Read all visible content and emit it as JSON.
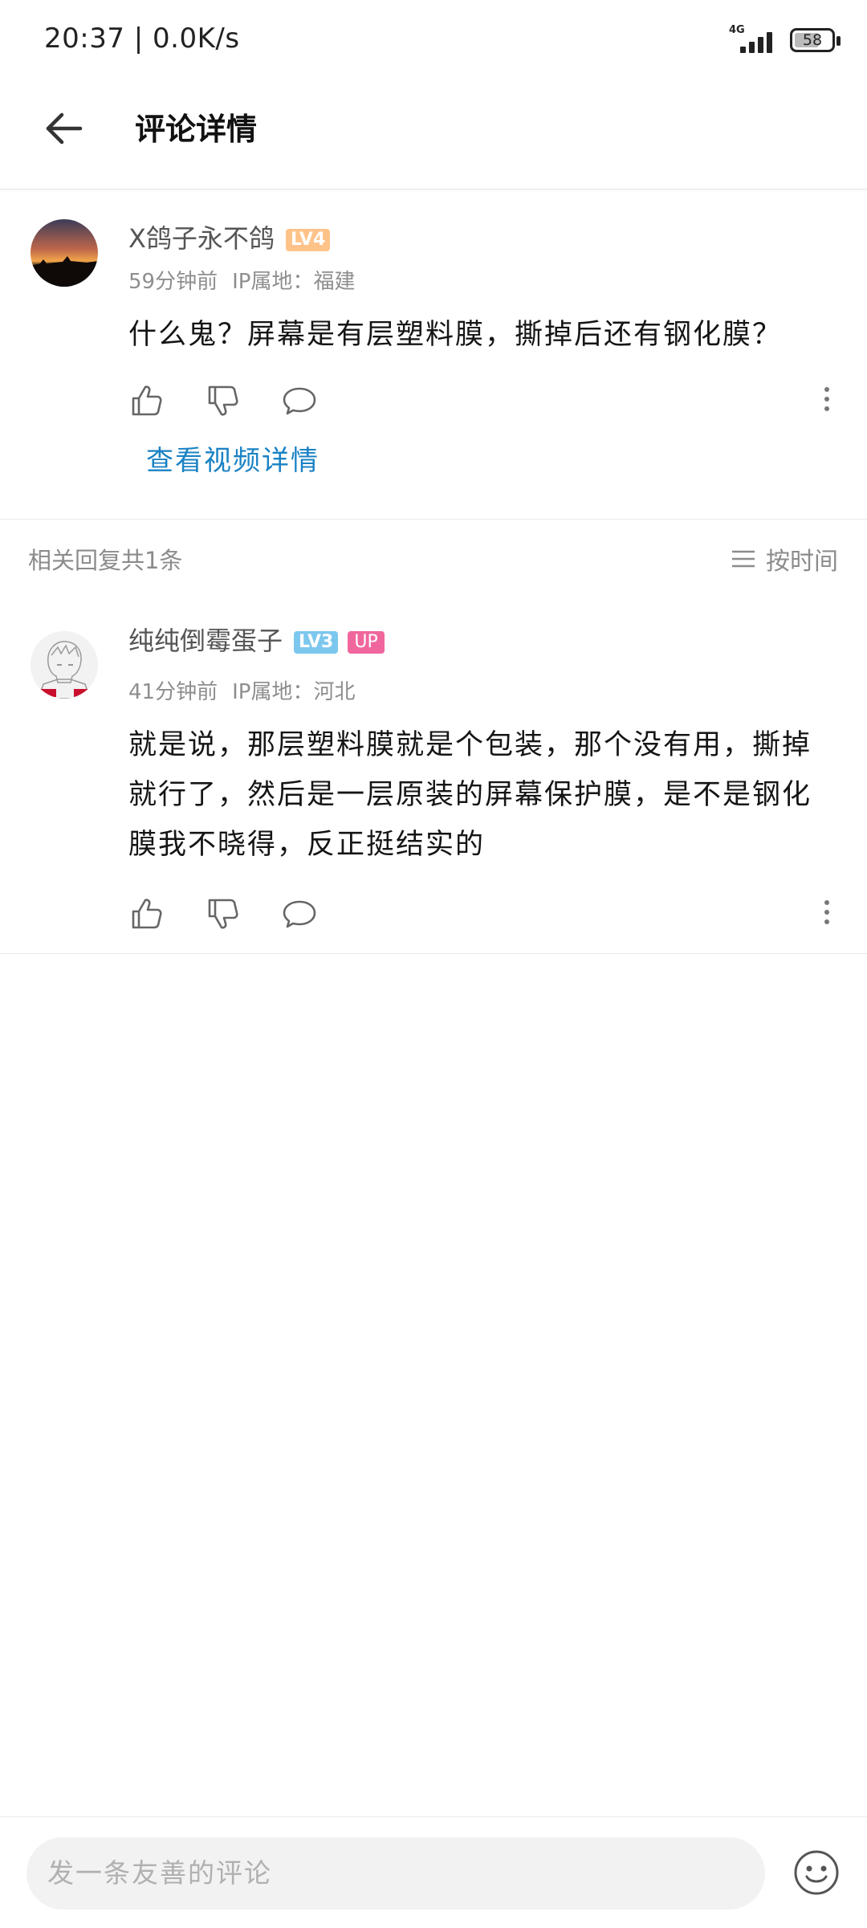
{
  "status_bar": {
    "time": "20:37 | 0.0K/s",
    "network": "4G",
    "battery": "58"
  },
  "header": {
    "title": "评论详情"
  },
  "main_comment": {
    "username": "X鸽子永不鸽",
    "level": "LV4",
    "time": "59分钟前",
    "ip": "IP属地：福建",
    "text": "什么鬼？屏幕是有层塑料膜，撕掉后还有钢化膜？",
    "view_video": "查看视频详情"
  },
  "replies_header": {
    "count": "相关回复共1条",
    "sort": "按时间"
  },
  "reply": {
    "username": "纯纯倒霉蛋子",
    "level": "LV3",
    "up_badge": "UP",
    "time": "41分钟前",
    "ip": "IP属地：河北",
    "text": "就是说，那层塑料膜就是个包装，那个没有用，撕掉就行了，然后是一层原装的屏幕保护膜，是不是钢化膜我不晓得，反正挺结实的"
  },
  "bottom_bar": {
    "input_placeholder": "发一条友善的评论"
  },
  "colors": {
    "link": "#1a82c4",
    "level4": "#ffc38a",
    "level3": "#7cc7ee",
    "up": "#f0679e"
  }
}
